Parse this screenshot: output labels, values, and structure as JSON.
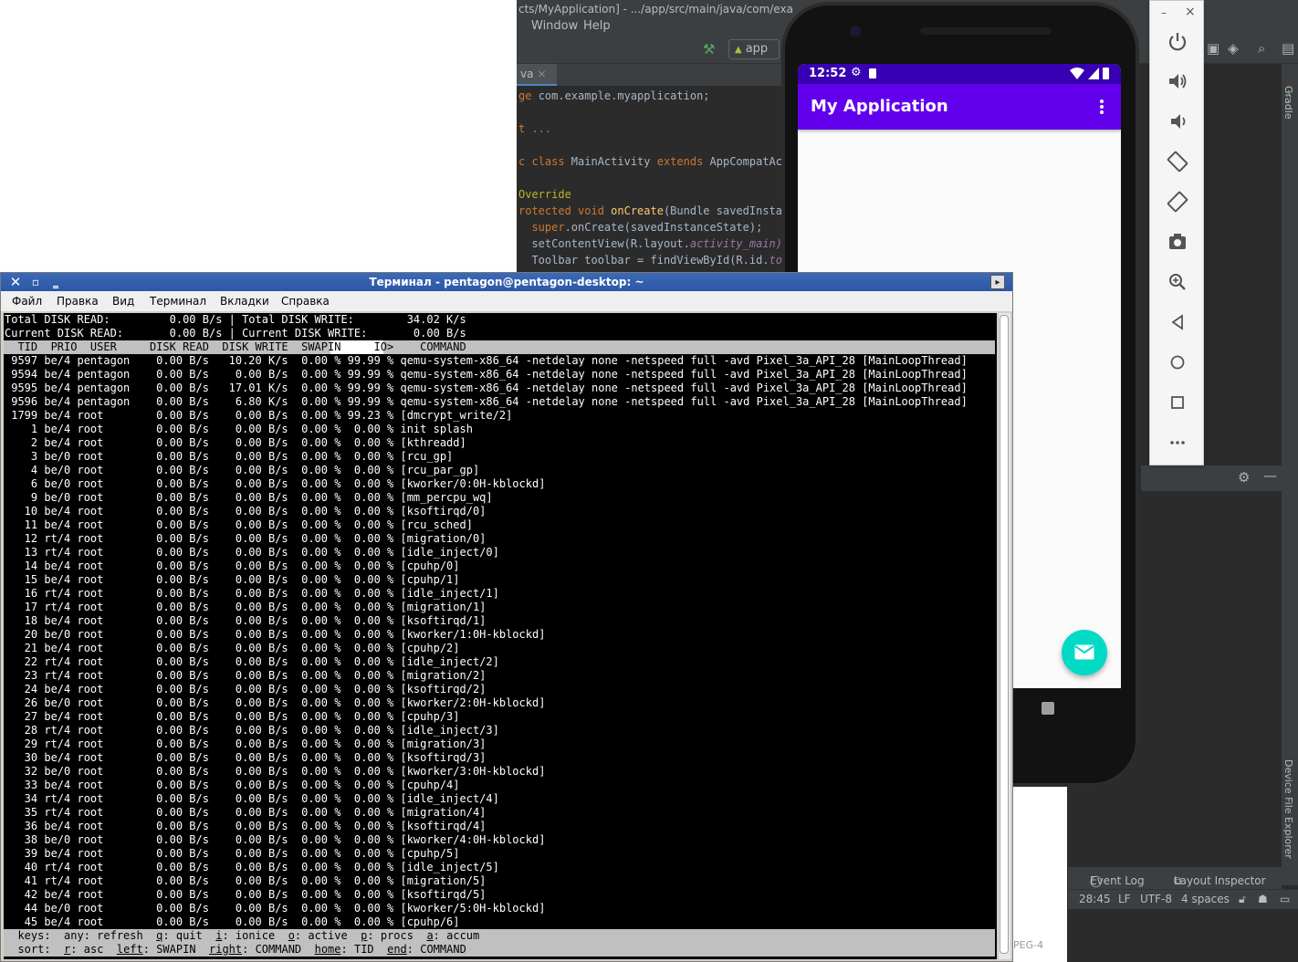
{
  "ide": {
    "title": "cts/MyApplication] - .../app/src/main/java/com/exa",
    "menu": [
      "Window",
      "Help"
    ],
    "run_config": "app",
    "editor_tab": "va",
    "code_lines": [
      {
        "pre": "ge ",
        "plain": "com.example.myapplication;",
        "post": ""
      },
      {
        "pre": "",
        "plain": "",
        "post": ""
      },
      {
        "pre": "t ",
        "plain": "...",
        "post": ""
      },
      {
        "pre": "",
        "plain": "",
        "post": ""
      },
      {
        "pre": "c class ",
        "plain": "MainActivity ",
        "post": "extends AppCompatActi"
      },
      {
        "pre": "",
        "plain": "",
        "post": ""
      },
      {
        "pre": "Override",
        "plain": "",
        "post": ""
      },
      {
        "pre": "rotected void ",
        "plain": "onCreate",
        "post": "(Bundle savedInstan"
      },
      {
        "pre": "  super",
        "plain": ".onCreate(savedInstanceState);",
        "post": ""
      },
      {
        "pre": "  ",
        "plain": "setContentView(R.layout.",
        "post": "activity_main)"
      },
      {
        "pre": "  ",
        "plain": "Toolbar toolbar = findViewById(R.id.",
        "post": "to"
      }
    ],
    "side_labels": {
      "gradle": "Gradle",
      "device_file_explorer": "Device File Explorer"
    },
    "bottom_tools": {
      "event_log": "Event Log",
      "layout_inspector": "Layout Inspector"
    },
    "status": {
      "position": "28:45",
      "line_sep": "LF",
      "encoding": "UTF-8",
      "indent": "4 spaces"
    },
    "peg_label": "PEG-4"
  },
  "emulator": {
    "time": "12:52",
    "app_title": "My Application",
    "tools": [
      "power-icon",
      "volume-up-icon",
      "volume-down-icon",
      "rotate-left-icon",
      "rotate-right-icon",
      "camera-icon",
      "zoom-icon",
      "back-icon",
      "home-icon",
      "overview-icon",
      "more-icon"
    ],
    "window_minimize": "–",
    "window_close": "×"
  },
  "terminal": {
    "title": "Терминал - pentagon@pentagon-desktop: ~",
    "menu": [
      "Файл",
      "Правка",
      "Вид",
      "Терминал",
      "Вкладки",
      "Справка"
    ],
    "summary": [
      "Total DISK READ:         0.00 B/s | Total DISK WRITE:        34.02 K/s",
      "Current DISK READ:       0.00 B/s | Current DISK WRITE:       0.00 B/s"
    ],
    "header": "  TID  PRIO  USER     DISK READ  DISK WRITE  SWAPIN     IO>    COMMAND",
    "rows": [
      " 9597 be/4 pentagon    0.00 B/s   10.20 K/s  0.00 % 99.99 % qemu-system-x86_64 -netdelay none -netspeed full -avd Pixel_3a_API_28 [MainLoopThread]",
      " 9594 be/4 pentagon    0.00 B/s    0.00 B/s  0.00 % 99.99 % qemu-system-x86_64 -netdelay none -netspeed full -avd Pixel_3a_API_28 [MainLoopThread]",
      " 9595 be/4 pentagon    0.00 B/s   17.01 K/s  0.00 % 99.99 % qemu-system-x86_64 -netdelay none -netspeed full -avd Pixel_3a_API_28 [MainLoopThread]",
      " 9596 be/4 pentagon    0.00 B/s    6.80 K/s  0.00 % 99.99 % qemu-system-x86_64 -netdelay none -netspeed full -avd Pixel_3a_API_28 [MainLoopThread]",
      " 1799 be/4 root        0.00 B/s    0.00 B/s  0.00 % 99.23 % [dmcrypt_write/2]",
      "    1 be/4 root        0.00 B/s    0.00 B/s  0.00 %  0.00 % init splash",
      "    2 be/4 root        0.00 B/s    0.00 B/s  0.00 %  0.00 % [kthreadd]",
      "    3 be/0 root        0.00 B/s    0.00 B/s  0.00 %  0.00 % [rcu_gp]",
      "    4 be/0 root        0.00 B/s    0.00 B/s  0.00 %  0.00 % [rcu_par_gp]",
      "    6 be/0 root        0.00 B/s    0.00 B/s  0.00 %  0.00 % [kworker/0:0H-kblockd]",
      "    9 be/0 root        0.00 B/s    0.00 B/s  0.00 %  0.00 % [mm_percpu_wq]",
      "   10 be/4 root        0.00 B/s    0.00 B/s  0.00 %  0.00 % [ksoftirqd/0]",
      "   11 be/4 root        0.00 B/s    0.00 B/s  0.00 %  0.00 % [rcu_sched]",
      "   12 rt/4 root        0.00 B/s    0.00 B/s  0.00 %  0.00 % [migration/0]",
      "   13 rt/4 root        0.00 B/s    0.00 B/s  0.00 %  0.00 % [idle_inject/0]",
      "   14 be/4 root        0.00 B/s    0.00 B/s  0.00 %  0.00 % [cpuhp/0]",
      "   15 be/4 root        0.00 B/s    0.00 B/s  0.00 %  0.00 % [cpuhp/1]",
      "   16 rt/4 root        0.00 B/s    0.00 B/s  0.00 %  0.00 % [idle_inject/1]",
      "   17 rt/4 root        0.00 B/s    0.00 B/s  0.00 %  0.00 % [migration/1]",
      "   18 be/4 root        0.00 B/s    0.00 B/s  0.00 %  0.00 % [ksoftirqd/1]",
      "   20 be/0 root        0.00 B/s    0.00 B/s  0.00 %  0.00 % [kworker/1:0H-kblockd]",
      "   21 be/4 root        0.00 B/s    0.00 B/s  0.00 %  0.00 % [cpuhp/2]",
      "   22 rt/4 root        0.00 B/s    0.00 B/s  0.00 %  0.00 % [idle_inject/2]",
      "   23 rt/4 root        0.00 B/s    0.00 B/s  0.00 %  0.00 % [migration/2]",
      "   24 be/4 root        0.00 B/s    0.00 B/s  0.00 %  0.00 % [ksoftirqd/2]",
      "   26 be/0 root        0.00 B/s    0.00 B/s  0.00 %  0.00 % [kworker/2:0H-kblockd]",
      "   27 be/4 root        0.00 B/s    0.00 B/s  0.00 %  0.00 % [cpuhp/3]",
      "   28 rt/4 root        0.00 B/s    0.00 B/s  0.00 %  0.00 % [idle_inject/3]",
      "   29 rt/4 root        0.00 B/s    0.00 B/s  0.00 %  0.00 % [migration/3]",
      "   30 be/4 root        0.00 B/s    0.00 B/s  0.00 %  0.00 % [ksoftirqd/3]",
      "   32 be/0 root        0.00 B/s    0.00 B/s  0.00 %  0.00 % [kworker/3:0H-kblockd]",
      "   33 be/4 root        0.00 B/s    0.00 B/s  0.00 %  0.00 % [cpuhp/4]",
      "   34 rt/4 root        0.00 B/s    0.00 B/s  0.00 %  0.00 % [idle_inject/4]",
      "   35 rt/4 root        0.00 B/s    0.00 B/s  0.00 %  0.00 % [migration/4]",
      "   36 be/4 root        0.00 B/s    0.00 B/s  0.00 %  0.00 % [ksoftirqd/4]",
      "   38 be/0 root        0.00 B/s    0.00 B/s  0.00 %  0.00 % [kworker/4:0H-kblockd]",
      "   39 be/4 root        0.00 B/s    0.00 B/s  0.00 %  0.00 % [cpuhp/5]",
      "   40 rt/4 root        0.00 B/s    0.00 B/s  0.00 %  0.00 % [idle_inject/5]",
      "   41 rt/4 root        0.00 B/s    0.00 B/s  0.00 %  0.00 % [migration/5]",
      "   42 be/4 root        0.00 B/s    0.00 B/s  0.00 %  0.00 % [ksoftirqd/5]",
      "   44 be/0 root        0.00 B/s    0.00 B/s  0.00 %  0.00 % [kworker/5:0H-kblockd]",
      "   45 be/4 root        0.00 B/s    0.00 B/s  0.00 %  0.00 % [cpuhp/6]"
    ],
    "keys_line1": [
      {
        "t": "  keys:  any: refresh  ",
        "u": false
      },
      {
        "t": "q",
        "u": true
      },
      {
        "t": ": quit  ",
        "u": false
      },
      {
        "t": "i",
        "u": true
      },
      {
        "t": ": ionice  ",
        "u": false
      },
      {
        "t": "o",
        "u": true
      },
      {
        "t": ": active  ",
        "u": false
      },
      {
        "t": "p",
        "u": true
      },
      {
        "t": ": procs  ",
        "u": false
      },
      {
        "t": "a",
        "u": true
      },
      {
        "t": ": accum",
        "u": false
      }
    ],
    "keys_line2": [
      {
        "t": "  sort:  ",
        "u": false
      },
      {
        "t": "r",
        "u": true
      },
      {
        "t": ": asc  ",
        "u": false
      },
      {
        "t": "left",
        "u": true
      },
      {
        "t": ": SWAPIN  ",
        "u": false
      },
      {
        "t": "right",
        "u": true
      },
      {
        "t": ": COMMAND  ",
        "u": false
      },
      {
        "t": "home",
        "u": true
      },
      {
        "t": ": TID  ",
        "u": false
      },
      {
        "t": "end",
        "u": true
      },
      {
        "t": ": COMMAND",
        "u": false
      }
    ]
  },
  "colors": {
    "terminal_bg": "#000000",
    "terminal_header_bar": "#c0c0c0",
    "titlebar_blue": "#2c57a4",
    "android_primary": "#6200ee",
    "android_primary_dark": "#3700b3",
    "fab": "#03dac5",
    "ide_bg": "#2b2b2b"
  }
}
